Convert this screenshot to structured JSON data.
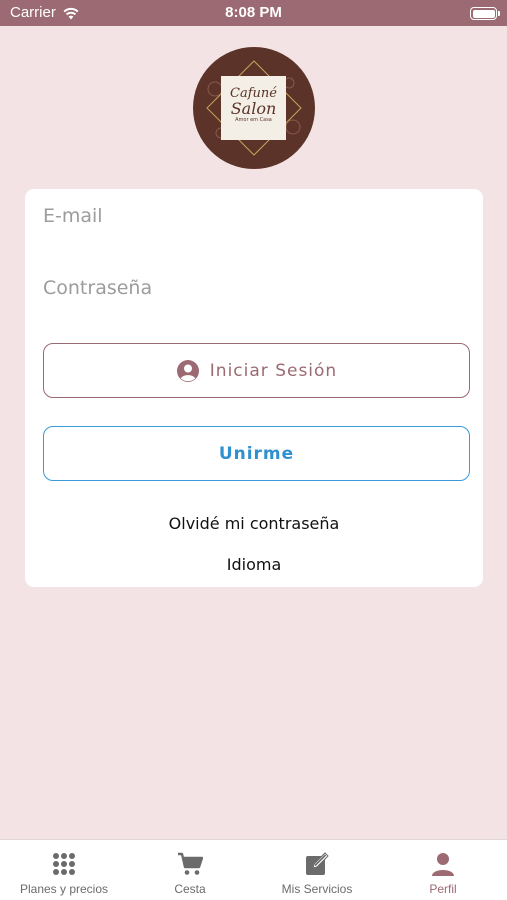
{
  "status_bar": {
    "carrier": "Carrier",
    "time": "8:08 PM"
  },
  "logo": {
    "line1": "Cafuné",
    "line2": "Salon",
    "line3": "Amor em Casa"
  },
  "login": {
    "email_placeholder": "E-mail",
    "password_placeholder": "Contraseña",
    "login_button": "Iniciar Sesión",
    "join_button": "Unirme",
    "forgot_link": "Olvidé mi contraseña",
    "language_link": "Idioma"
  },
  "tabs": [
    {
      "label": "Planes y precios",
      "icon": "grid-icon",
      "active": false
    },
    {
      "label": "Cesta",
      "icon": "cart-icon",
      "active": false
    },
    {
      "label": "Mis Servicios",
      "icon": "edit-icon",
      "active": false
    },
    {
      "label": "Perfil",
      "icon": "person-icon",
      "active": true
    }
  ],
  "colors": {
    "background": "#f3e3e4",
    "brand": "#9b6a72",
    "accent_blue": "#2f8fcf",
    "logo_brown": "#5b3328"
  }
}
